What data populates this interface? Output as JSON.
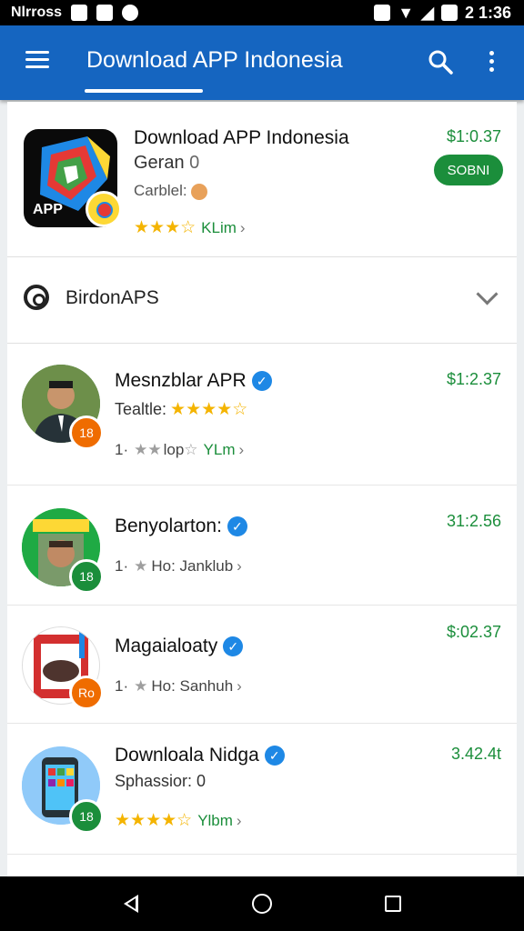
{
  "status_bar": {
    "carrier": "Nlrross",
    "time": "2 1:36"
  },
  "app_bar": {
    "title": "Download APP Indonesia",
    "menu_icon": "hamburger-icon",
    "search_icon": "search-icon",
    "more_icon": "more-vert-icon"
  },
  "featured": {
    "title": "Download APP Indonesia",
    "subtitle": "Geran",
    "subtitle_extra": "0",
    "category": "Carblel:",
    "icon_label": "APP",
    "price": "$1:0.37",
    "install_label": "SOBNI",
    "rating_label": "KLim"
  },
  "section": {
    "label": "BirdonAPS"
  },
  "rows": [
    {
      "title": "Mesnzblar APR",
      "sub": "Tealtle:",
      "meta_prefix": "1·",
      "meta_text": "lop",
      "rating_label": "YLm",
      "price": "$1:2.37",
      "badge": "18"
    },
    {
      "title": "Benyolarton:",
      "meta_prefix": "1·",
      "meta_text": "Ho: Janklub",
      "price": "31:2.56",
      "badge": "18"
    },
    {
      "title": "Magaialoaty",
      "meta_prefix": "1·",
      "meta_text": "Ho: Sanhuh",
      "price": "$:02.37",
      "badge": "Ro"
    },
    {
      "title": "Downloala Nidga",
      "sub": "Sphassior: 0",
      "rating_label": "Ylbm",
      "price": "3.42.4t",
      "badge": "18"
    }
  ],
  "colors": {
    "app_bar": "#1565c0",
    "price_green": "#1b8e3b",
    "star": "#f4b400",
    "verified": "#1e88e5"
  }
}
